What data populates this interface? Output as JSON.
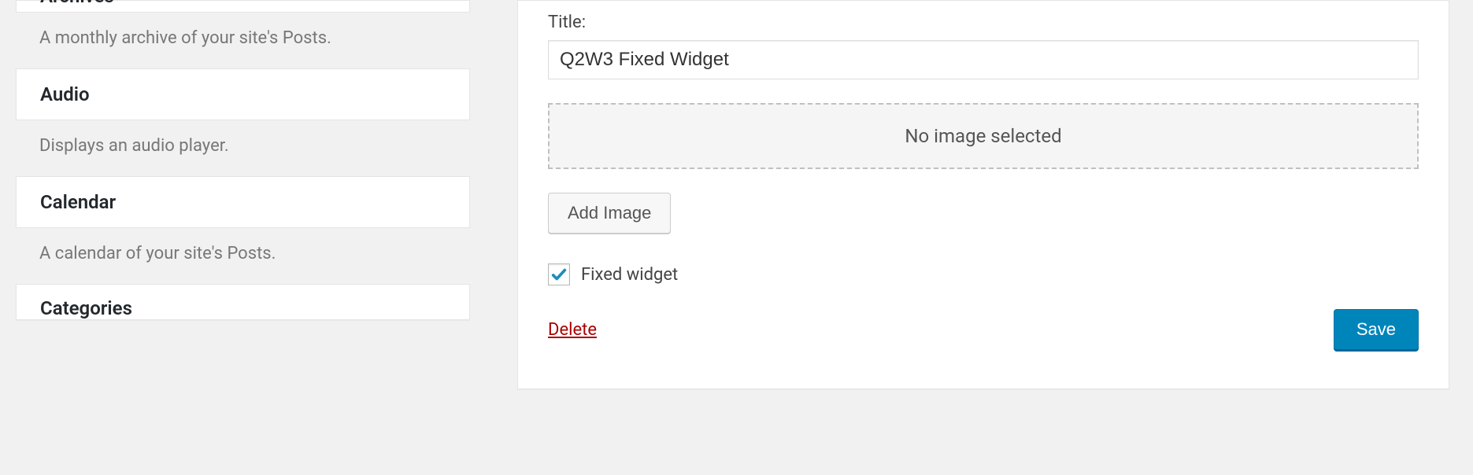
{
  "widgets": {
    "archives": {
      "title": "Archives",
      "description": "A monthly archive of your site's Posts."
    },
    "audio": {
      "title": "Audio",
      "description": "Displays an audio player."
    },
    "calendar": {
      "title": "Calendar",
      "description": "A calendar of your site's Posts."
    },
    "categories": {
      "title": "Categories"
    }
  },
  "form": {
    "title_label": "Title:",
    "title_value": "Q2W3 Fixed Widget",
    "dropzone_text": "No image selected",
    "add_image_label": "Add Image",
    "fixed_widget_label": "Fixed widget",
    "fixed_widget_checked": true,
    "delete_label": "Delete",
    "save_label": "Save"
  }
}
